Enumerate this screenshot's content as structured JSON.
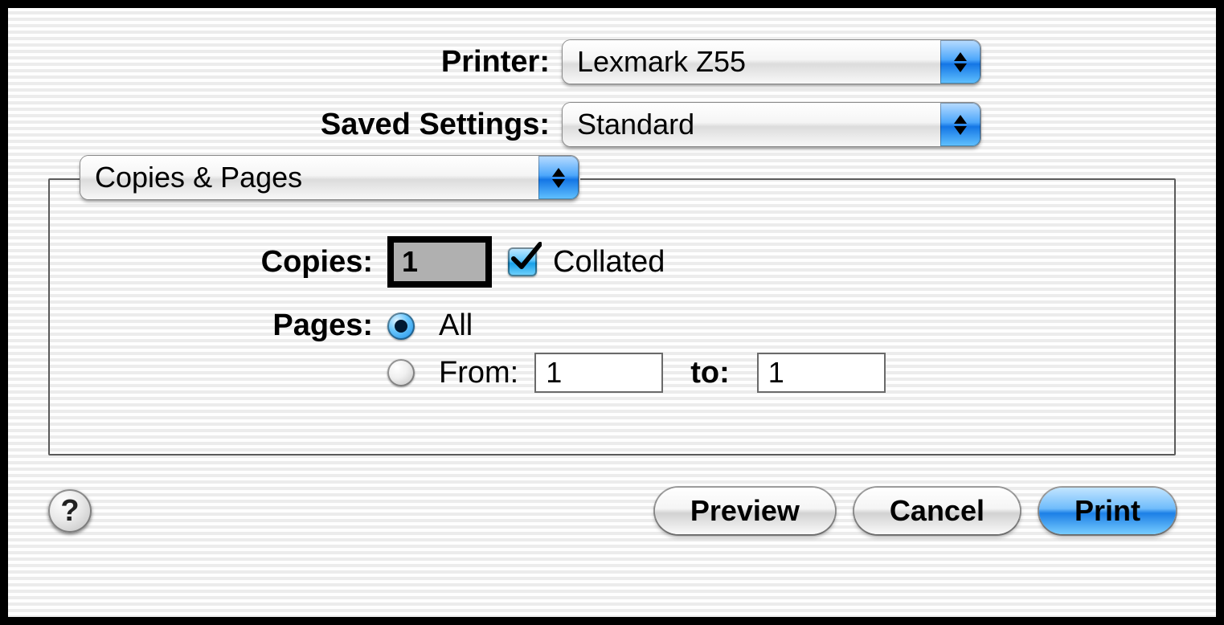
{
  "printer": {
    "label": "Printer:",
    "value": "Lexmark Z55"
  },
  "saved_settings": {
    "label": "Saved Settings:",
    "value": "Standard"
  },
  "section": {
    "value": "Copies & Pages"
  },
  "copies": {
    "label": "Copies:",
    "value": "1"
  },
  "collated": {
    "label": "Collated",
    "checked": true
  },
  "pages": {
    "label": "Pages:",
    "option_all": "All",
    "option_from": "From:",
    "to_label": "to:",
    "from_value": "1",
    "to_value": "1",
    "selected": "all"
  },
  "buttons": {
    "preview": "Preview",
    "cancel": "Cancel",
    "print": "Print"
  },
  "help_glyph": "?"
}
